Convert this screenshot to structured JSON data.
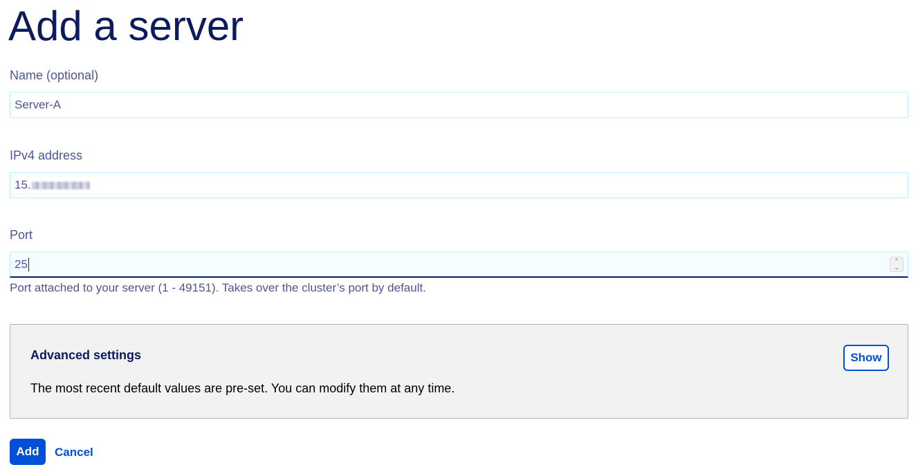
{
  "page": {
    "title": "Add a server"
  },
  "form": {
    "name": {
      "label": "Name (optional)",
      "value": "Server-A"
    },
    "ipv4": {
      "label": "IPv4 address",
      "value_visible_prefix": "15."
    },
    "port": {
      "label": "Port",
      "value": "25",
      "helper": "Port attached to your server (1 - 49151). Takes over the cluster’s port by default."
    }
  },
  "advanced": {
    "title": "Advanced settings",
    "description": "The most recent default values are pre-set. You can modify them at any time.",
    "show_label": "Show"
  },
  "actions": {
    "add_label": "Add",
    "cancel_label": "Cancel"
  },
  "colors": {
    "title": "#0b1b5e",
    "text": "#4d5693",
    "primary": "#0050d7",
    "input_border": "#bef1ff",
    "panel_bg": "#f2f2f2"
  },
  "icons": {
    "spinner": "number-spinner-icon"
  }
}
